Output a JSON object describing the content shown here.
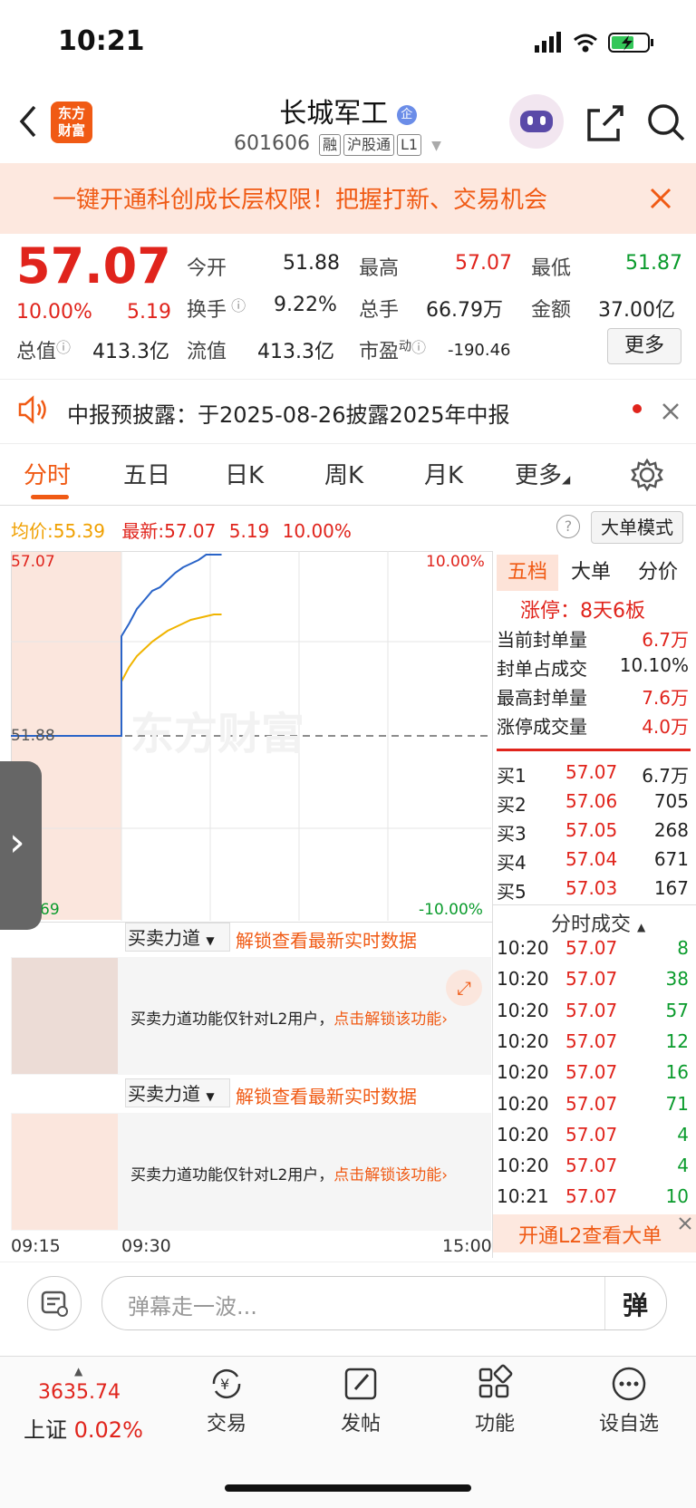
{
  "status": {
    "time": "10:21"
  },
  "header": {
    "logo": "东方\n财富",
    "stock_name": "长城军工",
    "stock_code": "601606",
    "tags": [
      "融",
      "沪股通",
      "L1"
    ]
  },
  "banner": {
    "text": "一键开通科创成长层权限！把握打新、交易机会"
  },
  "quote": {
    "price": "57.07",
    "pct": "10.00%",
    "change": "5.19",
    "open_label": "今开",
    "open": "51.88",
    "high_label": "最高",
    "high": "57.07",
    "low_label": "最低",
    "low": "51.87",
    "turnover_label": "换手",
    "turnover": "9.22%",
    "volume_label": "总手",
    "volume": "66.79万",
    "amount_label": "金额",
    "amount": "37.00亿",
    "mktcap_label": "总值",
    "mktcap": "413.3亿",
    "float_label": "流值",
    "float": "413.3亿",
    "pe_label": "市盈",
    "pe_sup": "动",
    "pe": "-190.46",
    "more": "更多"
  },
  "notice": {
    "text": "中报预披露：于2025-08-26披露2025年中报"
  },
  "tabs": [
    "分时",
    "五日",
    "日K",
    "周K",
    "月K",
    "更多"
  ],
  "info_line": {
    "avg_label": "均价:",
    "avg": "55.39",
    "latest_label": "最新:",
    "latest": "57.07",
    "change": "5.19",
    "pct": "10.00%",
    "mode_button": "大单模式"
  },
  "chart": {
    "top_price": "57.07",
    "mid_price": "51.88",
    "bottom_price": "69",
    "top_pct": "10.00%",
    "bottom_pct": "-10.00%",
    "watermark": "东方财富",
    "time_labels": [
      "09:15",
      "09:30",
      "15:00"
    ],
    "colors": {
      "price": "#2a64c8",
      "avg": "#f0b400"
    },
    "price_line": [
      0.0,
      0.0,
      0.0,
      0.0,
      0.0,
      0.0,
      0.0,
      0.0,
      0.0,
      0.55,
      0.62,
      0.7,
      0.75,
      0.8,
      0.82,
      0.86,
      0.9,
      0.93,
      0.95,
      0.97,
      1.0,
      1.0,
      1.0
    ],
    "avg_line": [
      0.0,
      0.0,
      0.0,
      0.0,
      0.0,
      0.0,
      0.0,
      0.0,
      0.0,
      0.3,
      0.38,
      0.44,
      0.48,
      0.52,
      0.55,
      0.58,
      0.6,
      0.62,
      0.64,
      0.65,
      0.66,
      0.67,
      0.67
    ]
  },
  "power_panels": [
    {
      "dropdown": "买卖力道",
      "link": "解锁查看最新实时数据",
      "msg": "买卖力道功能仅针对L2用户，",
      "msg_link": "点击解锁该功能"
    },
    {
      "dropdown": "买卖力道",
      "link": "解锁查看最新实时数据",
      "msg": "买卖力道功能仅针对L2用户，",
      "msg_link": "点击解锁该功能"
    }
  ],
  "right_panel": {
    "tabs": [
      "五档",
      "大单",
      "分价"
    ],
    "limit_title": "涨停：8天6板",
    "seal_rows": [
      {
        "label": "当前封单量",
        "value": "6.7万"
      },
      {
        "label": "封单占成交",
        "value": "10.10%"
      },
      {
        "label": "最高封单量",
        "value": "7.6万"
      },
      {
        "label": "涨停成交量",
        "value": "4.0万"
      }
    ],
    "bids": [
      {
        "label": "买1",
        "price": "57.07",
        "vol": "6.7万"
      },
      {
        "label": "买2",
        "price": "57.06",
        "vol": "705"
      },
      {
        "label": "买3",
        "price": "57.05",
        "vol": "268"
      },
      {
        "label": "买4",
        "price": "57.04",
        "vol": "671"
      },
      {
        "label": "买5",
        "price": "57.03",
        "vol": "167"
      }
    ],
    "ticks_title": "分时成交",
    "ticks": [
      {
        "time": "10:20",
        "price": "57.07",
        "vol": "8"
      },
      {
        "time": "10:20",
        "price": "57.07",
        "vol": "38"
      },
      {
        "time": "10:20",
        "price": "57.07",
        "vol": "57"
      },
      {
        "time": "10:20",
        "price": "57.07",
        "vol": "12"
      },
      {
        "time": "10:20",
        "price": "57.07",
        "vol": "16"
      },
      {
        "time": "10:20",
        "price": "57.07",
        "vol": "71"
      },
      {
        "time": "10:20",
        "price": "57.07",
        "vol": "4"
      },
      {
        "time": "10:20",
        "price": "57.07",
        "vol": "4"
      },
      {
        "time": "10:21",
        "price": "57.07",
        "vol": "10"
      }
    ],
    "l2_promo": "开通L2查看大单"
  },
  "danmu": {
    "placeholder": "弹幕走一波...",
    "button": "弹"
  },
  "tabbar": {
    "index_value": "3635.74",
    "index_name": "上证",
    "index_pct": "0.02%",
    "items": [
      "交易",
      "发帖",
      "功能",
      "设自选"
    ]
  }
}
